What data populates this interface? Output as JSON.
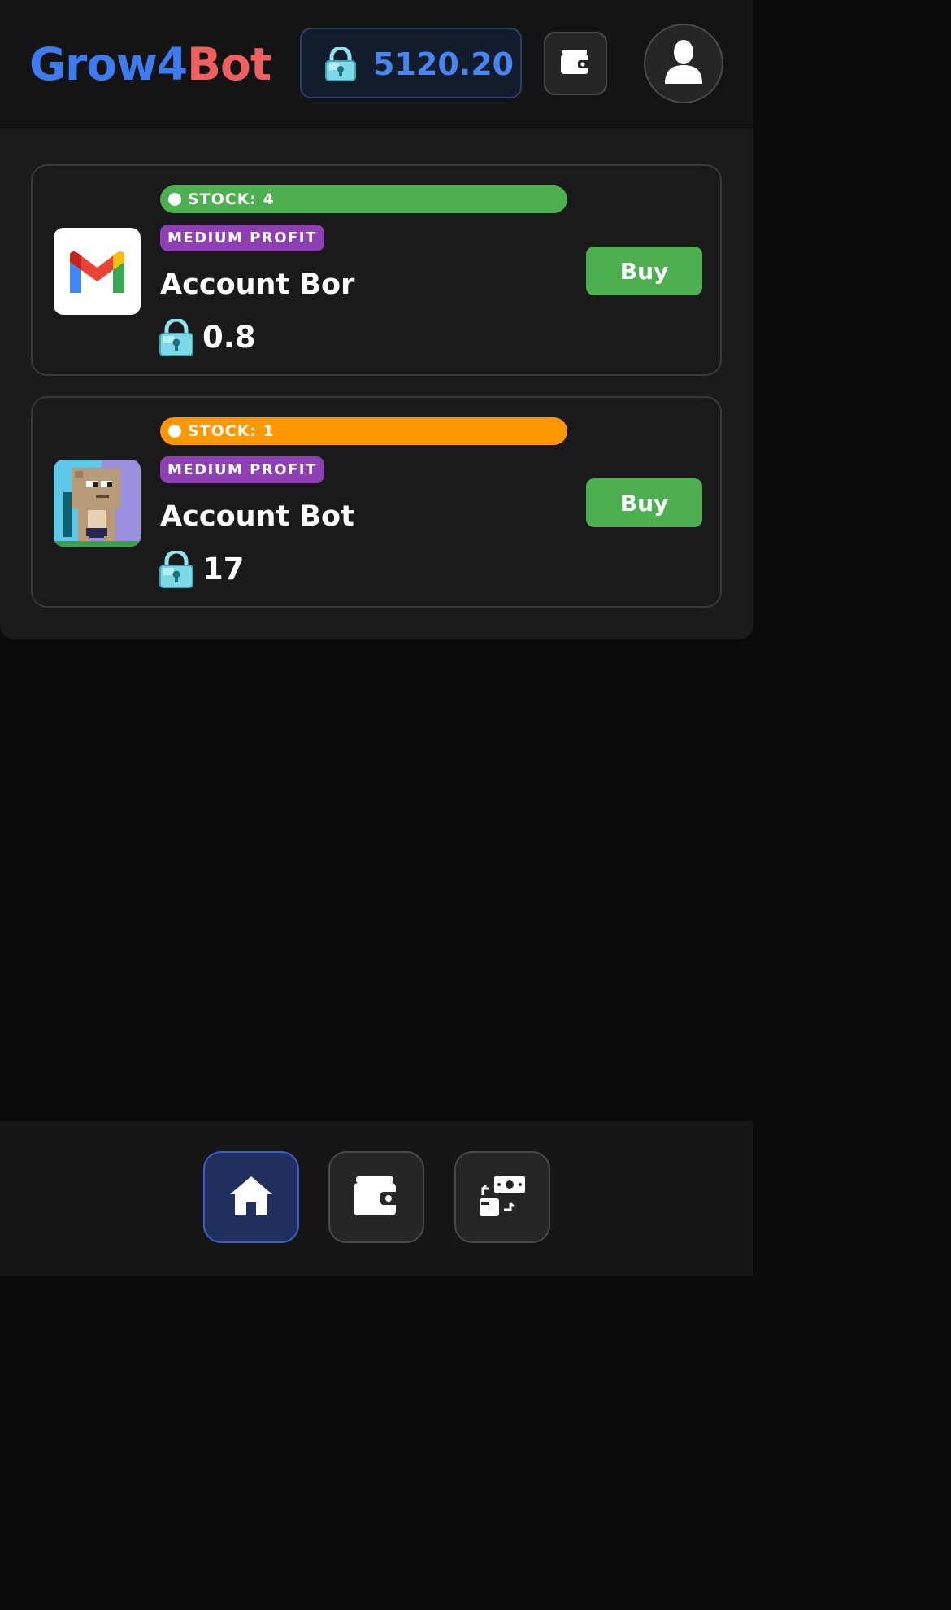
{
  "header": {
    "logo_part1": "Grow4",
    "logo_part2": "Bot",
    "balance": "5120.20",
    "balance_icon": "diamond-lock-icon",
    "wallet_icon": "wallet-icon",
    "profile_icon": "user-icon"
  },
  "products": [
    {
      "stock_label": "STOCK: 4",
      "stock_color": "#4caf50",
      "profit_badge": "MEDIUM PROFIT",
      "title": "Account Bor",
      "price": "0.8",
      "image": "gmail-logo",
      "buy_label": "Buy"
    },
    {
      "stock_label": "STOCK: 1",
      "stock_color": "#ff9800",
      "profit_badge": "MEDIUM PROFIT",
      "title": "Account Bot",
      "price": "17",
      "image": "growtopia-character",
      "buy_label": "Buy"
    }
  ],
  "bottom_nav": {
    "items": [
      {
        "icon": "home-icon",
        "active": true
      },
      {
        "icon": "wallet-icon",
        "active": false
      },
      {
        "icon": "exchange-icon",
        "active": false
      }
    ]
  },
  "colors": {
    "accent_blue": "#3f7bf0",
    "accent_red": "#f0605f",
    "buy_green": "#4caf50",
    "badge_purple": "#8e3fb4"
  }
}
